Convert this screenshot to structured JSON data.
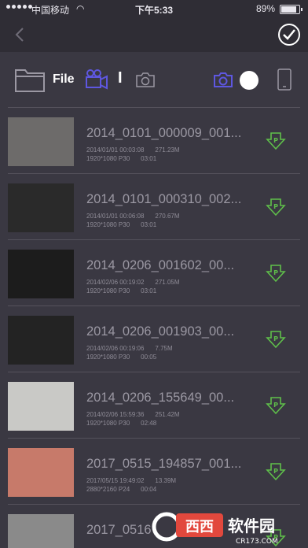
{
  "status_bar": {
    "carrier": "中国移动",
    "time": "下午5:33",
    "battery_percent": "89%",
    "battery_level": 0.89
  },
  "toolbar": {
    "file_label": "File",
    "separator": "I"
  },
  "files": [
    {
      "name": "2014_0101_000009_001...",
      "date": "2014/01/01 00:03:08",
      "size": "271.23M",
      "resolution": "1920*1080 P30",
      "duration": "03:01",
      "thumb": "#6d6b6a"
    },
    {
      "name": "2014_0101_000310_002...",
      "date": "2014/01/01 00:06:08",
      "size": "270.67M",
      "resolution": "1920*1080 P30",
      "duration": "03:01",
      "thumb": "#2a2a2a"
    },
    {
      "name": "2014_0206_001602_00...",
      "date": "2014/02/06 00:19:02",
      "size": "271.05M",
      "resolution": "1920*1080 P30",
      "duration": "03:01",
      "thumb": "#1c1c1c"
    },
    {
      "name": "2014_0206_001903_00...",
      "date": "2014/02/06 00:19:06",
      "size": "7.75M",
      "resolution": "1920*1080 P30",
      "duration": "00:05",
      "thumb": "#232323"
    },
    {
      "name": "2014_0206_155649_00...",
      "date": "2014/02/06 15:59:36",
      "size": "251.42M",
      "resolution": "1920*1080 P30",
      "duration": "02:48",
      "thumb": "#c9c9c6"
    },
    {
      "name": "2017_0515_194857_001...",
      "date": "2017/05/15 19:49:02",
      "size": "13.39M",
      "resolution": "2880*2160 P24",
      "duration": "00:04",
      "thumb": "#c77a6a"
    },
    {
      "name": "2017_0516",
      "date": "",
      "size": "",
      "resolution": "",
      "duration": "",
      "thumb": "#8a8a8a"
    }
  ],
  "watermark": {
    "text": "软件园",
    "url": "CR173.COM"
  },
  "colors": {
    "background": "#3a3842",
    "header": "#2f2d35",
    "accent_blue": "#5e57e0",
    "download_green": "#5fbf4a"
  }
}
